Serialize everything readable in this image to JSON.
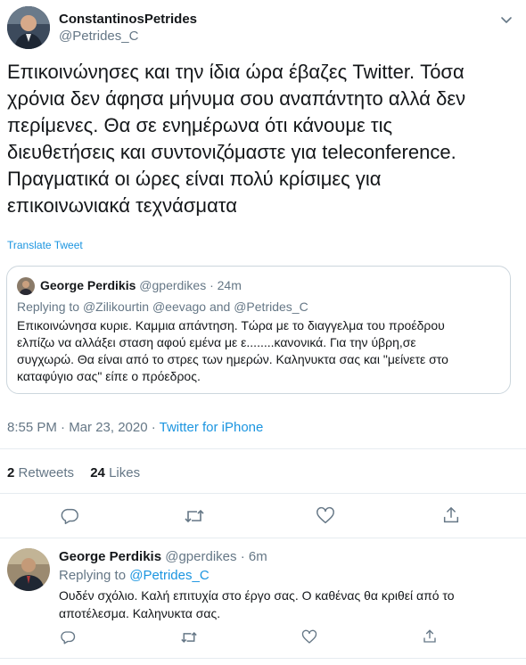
{
  "tweet": {
    "author_name": "ConstantinosPetrides",
    "author_handle": "@Petrides_C",
    "text_lines": [
      "Επικοινώνησες και την ίδια ώρα έβαζες Twitter. Τόσα",
      "χρόνια δεν άφησα μήνυμα σου αναπάντητο αλλά δεν",
      "περίμενες. Θα σε ενημέρωνα ότι κάνουμε τις",
      "διευθετήσεις και συντονιζόμαστε για teleconference.",
      "Πραγματικά οι ώρες είναι πολύ κρίσιμες για",
      "επικοινωνιακά τεχνάσματα"
    ],
    "translate": "Translate Tweet",
    "timestamp": "8:55 PM · Mar 23, 2020 · ",
    "source": "Twitter for iPhone",
    "retweets_count": "2",
    "retweets_label": "Retweets",
    "likes_count": "24",
    "likes_label": "Likes"
  },
  "quoted": {
    "author_name": "George Perdikis",
    "author_handle": "@gperdikes",
    "time": "· 24m",
    "replying_prefix": "Replying to ",
    "replying_to": "@Zilikourtin @eevago and @Petrides_C",
    "text_lines": [
      "Επικοινώνησα κυριε. Καμμια απάντηση. Τώρα με το διαγγελμα του προέδρου",
      "ελπίζω να αλλάξει σταση αφού εμένα με ε........κανονικά. Για την ύβρη,σε",
      "συγχωρώ. Θα είναι από το στρες των ημερών. Καληνυκτα σας και \"μείνετε στο",
      "καταφύγιο σας\" είπε ο πρόεδρος."
    ]
  },
  "reply": {
    "author_name": "George Perdikis",
    "author_handle": "@gperdikes",
    "time": "· 6m",
    "replying_prefix": "Replying to ",
    "replying_to": "@Petrides_C",
    "text_lines": [
      "Ουδέν σχόλιο. Καλή επιτυχία στο έργο σας. Ο καθένας θα κριθεί από το",
      "αποτέλεσμα. Καληνυκτα σας."
    ]
  },
  "icons": {
    "more": "chevron-down-icon",
    "reply": "reply-icon",
    "retweet": "retweet-icon",
    "like": "heart-icon",
    "share": "share-icon"
  },
  "colors": {
    "link": "#1b95e0",
    "muted": "#657786",
    "text": "#14171a",
    "border": "#e6ecf0"
  }
}
